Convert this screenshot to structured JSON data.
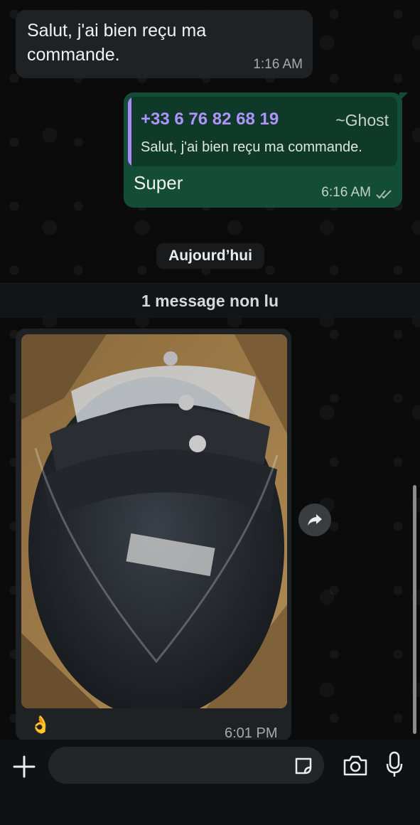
{
  "messages": {
    "incoming_1": {
      "text": "Salut, j'ai bien reçu ma commande.",
      "time": "1:16 AM"
    },
    "outgoing_1": {
      "quote": {
        "phone": "+33 6 76 82 68 19",
        "alias": "~Ghost",
        "text": "Salut, j'ai bien reçu ma commande."
      },
      "text": "Super",
      "time": "6:16 AM",
      "status": "read"
    },
    "date_divider": "Aujourd’hui",
    "unread_banner": "1 message non lu",
    "incoming_media": {
      "type": "photo",
      "reaction": "👌",
      "time": "6:01 PM"
    }
  },
  "composer": {
    "placeholder": ""
  },
  "icons": {
    "plus": "plus-icon",
    "sticker": "sticker-icon",
    "camera": "camera-icon",
    "mic": "microphone-icon",
    "forward": "forward-arrow-icon",
    "ticks": "double-check-icon"
  },
  "colors": {
    "background": "#0b0b0b",
    "incoming_bubble": "#1f2224",
    "outgoing_bubble": "#144d37",
    "quote_accent": "#a78bfa"
  }
}
